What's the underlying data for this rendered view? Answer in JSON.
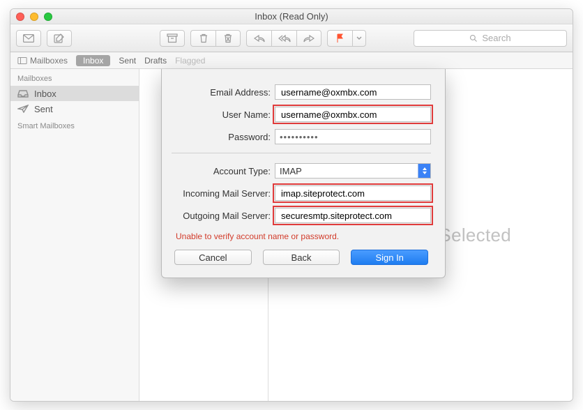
{
  "window": {
    "title": "Inbox (Read Only)"
  },
  "search": {
    "placeholder": "Search"
  },
  "filterbar": {
    "mailboxes": "Mailboxes",
    "inbox": "Inbox",
    "sent": "Sent",
    "drafts": "Drafts",
    "flagged": "Flagged"
  },
  "sidebar": {
    "header": "Mailboxes",
    "items": [
      {
        "label": "Inbox"
      },
      {
        "label": "Sent"
      }
    ],
    "smart_header": "Smart Mailboxes"
  },
  "preview": {
    "empty_text": "No Message Selected"
  },
  "sheet": {
    "labels": {
      "email": "Email Address:",
      "username": "User Name:",
      "password": "Password:",
      "account_type": "Account Type:",
      "incoming": "Incoming Mail Server:",
      "outgoing": "Outgoing Mail Server:"
    },
    "values": {
      "email": "username@oxmbx.com",
      "username": "username@oxmbx.com",
      "password_mask": "••••••••••",
      "account_type": "IMAP",
      "incoming": "imap.siteprotect.com",
      "outgoing": "securesmtp.siteprotect.com"
    },
    "error": "Unable to verify account name or password.",
    "buttons": {
      "cancel": "Cancel",
      "back": "Back",
      "signin": "Sign In"
    }
  }
}
